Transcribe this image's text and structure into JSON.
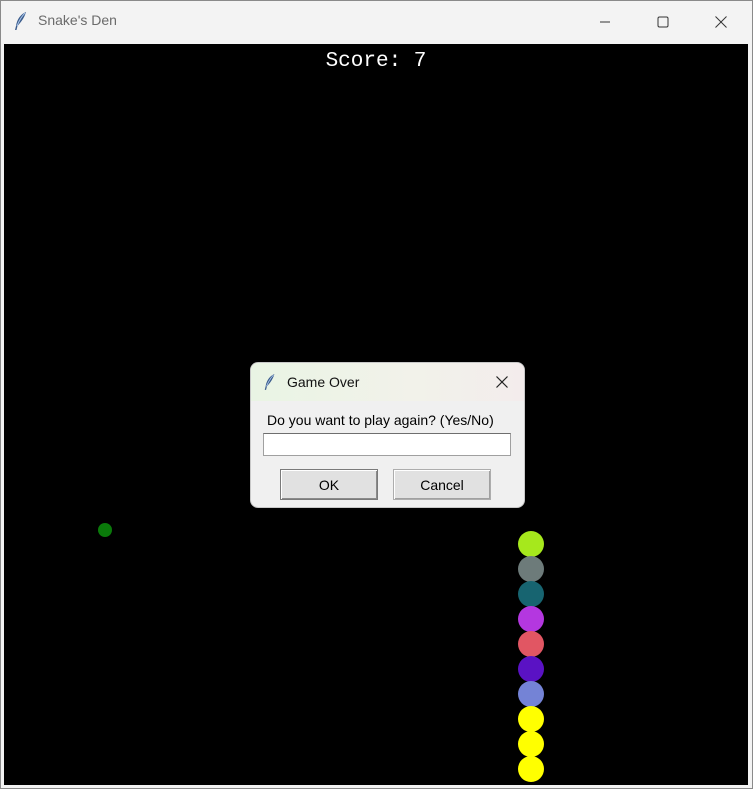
{
  "window": {
    "title": "Snake's Den",
    "icon": "feather-icon",
    "controls": [
      "minimize-icon",
      "maximize-icon",
      "close-icon"
    ]
  },
  "game": {
    "score_text": "Score: 7",
    "background_color": "#000000",
    "food_color": "#0a7a0a",
    "snake_segment_colors": [
      "#a6e81c",
      "#6d7b7a",
      "#176470",
      "#b437e0",
      "#e15663",
      "#5a12c4",
      "#7483d6",
      "#ffff00",
      "#ffff00",
      "#ffff00"
    ]
  },
  "dialog": {
    "title": "Game Over",
    "icon": "feather-icon",
    "prompt": "Do you want to play again? (Yes/No)",
    "input_value": "",
    "ok_label": "OK",
    "cancel_label": "Cancel"
  }
}
